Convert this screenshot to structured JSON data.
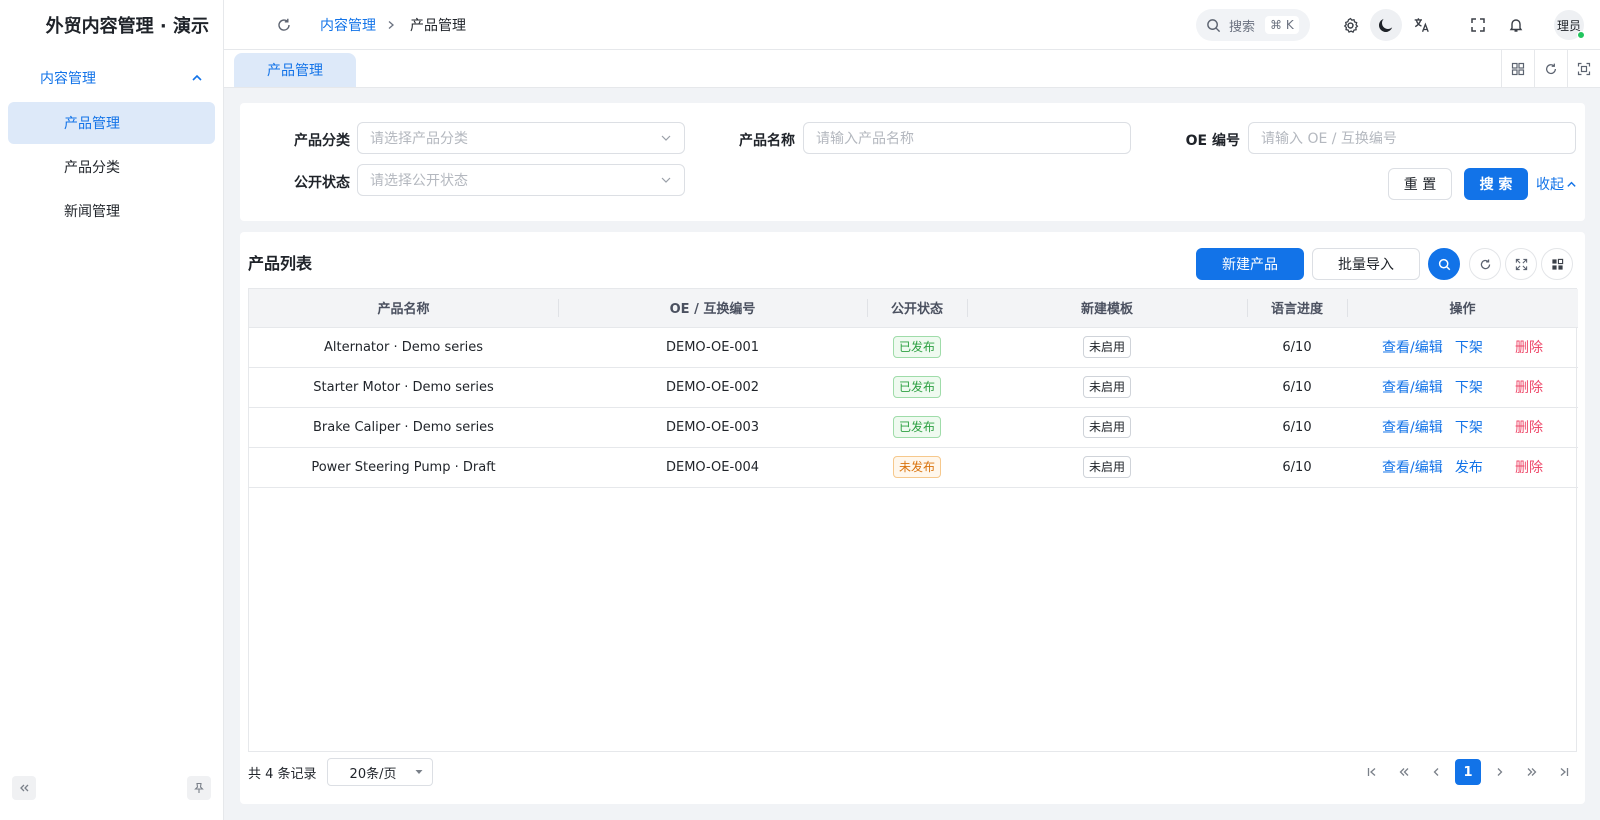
{
  "sidebar": {
    "brand": "外贸内容管理 · 演示",
    "group_label": "内容管理",
    "items": [
      {
        "label": "产品管理"
      },
      {
        "label": "产品分类"
      },
      {
        "label": "新闻管理"
      }
    ]
  },
  "header": {
    "breadcrumb_parent": "内容管理",
    "breadcrumb_current": "产品管理",
    "search_label": "搜索",
    "search_shortcut": "⌘ K",
    "avatar_text": "理员"
  },
  "tabs": [
    {
      "label": "产品管理"
    }
  ],
  "filter": {
    "category_label": "产品分类",
    "category_placeholder": "请选择产品分类",
    "name_label": "产品名称",
    "name_placeholder": "请输入产品名称",
    "oe_label": "OE 编号",
    "oe_placeholder": "请输入 OE / 互换编号",
    "status_label": "公开状态",
    "status_placeholder": "请选择公开状态",
    "reset_label": "重 置",
    "search_label": "搜 索",
    "collapse_label": "收起"
  },
  "table": {
    "title": "产品列表",
    "new_label": "新建产品",
    "import_label": "批量导入",
    "columns": [
      "产品名称",
      "OE / 互换编号",
      "公开状态",
      "新建模板",
      "语言进度",
      "操作"
    ],
    "rows": [
      {
        "name": "Alternator · Demo series",
        "oe": "DEMO-OE-001",
        "status": "已发布",
        "template": "未启用",
        "progress": "6/10",
        "edit": "查看/编辑",
        "toggle": "下架",
        "delete": "删除"
      },
      {
        "name": "Starter Motor · Demo series",
        "oe": "DEMO-OE-002",
        "status": "已发布",
        "template": "未启用",
        "progress": "6/10",
        "edit": "查看/编辑",
        "toggle": "下架",
        "delete": "删除"
      },
      {
        "name": "Brake Caliper · Demo series",
        "oe": "DEMO-OE-003",
        "status": "已发布",
        "template": "未启用",
        "progress": "6/10",
        "edit": "查看/编辑",
        "toggle": "下架",
        "delete": "删除"
      },
      {
        "name": "Power Steering Pump · Draft",
        "oe": "DEMO-OE-004",
        "status": "未发布",
        "template": "未启用",
        "progress": "6/10",
        "edit": "查看/编辑",
        "toggle": "发布",
        "delete": "删除"
      }
    ]
  },
  "pagination": {
    "total_text": "共 4 条记录",
    "page_size": "20条/页",
    "current_page": "1"
  },
  "colors": {
    "primary": "#1273e8",
    "published": "#2ea143",
    "unpublished": "#d9730d",
    "danger": "#ee4768"
  }
}
